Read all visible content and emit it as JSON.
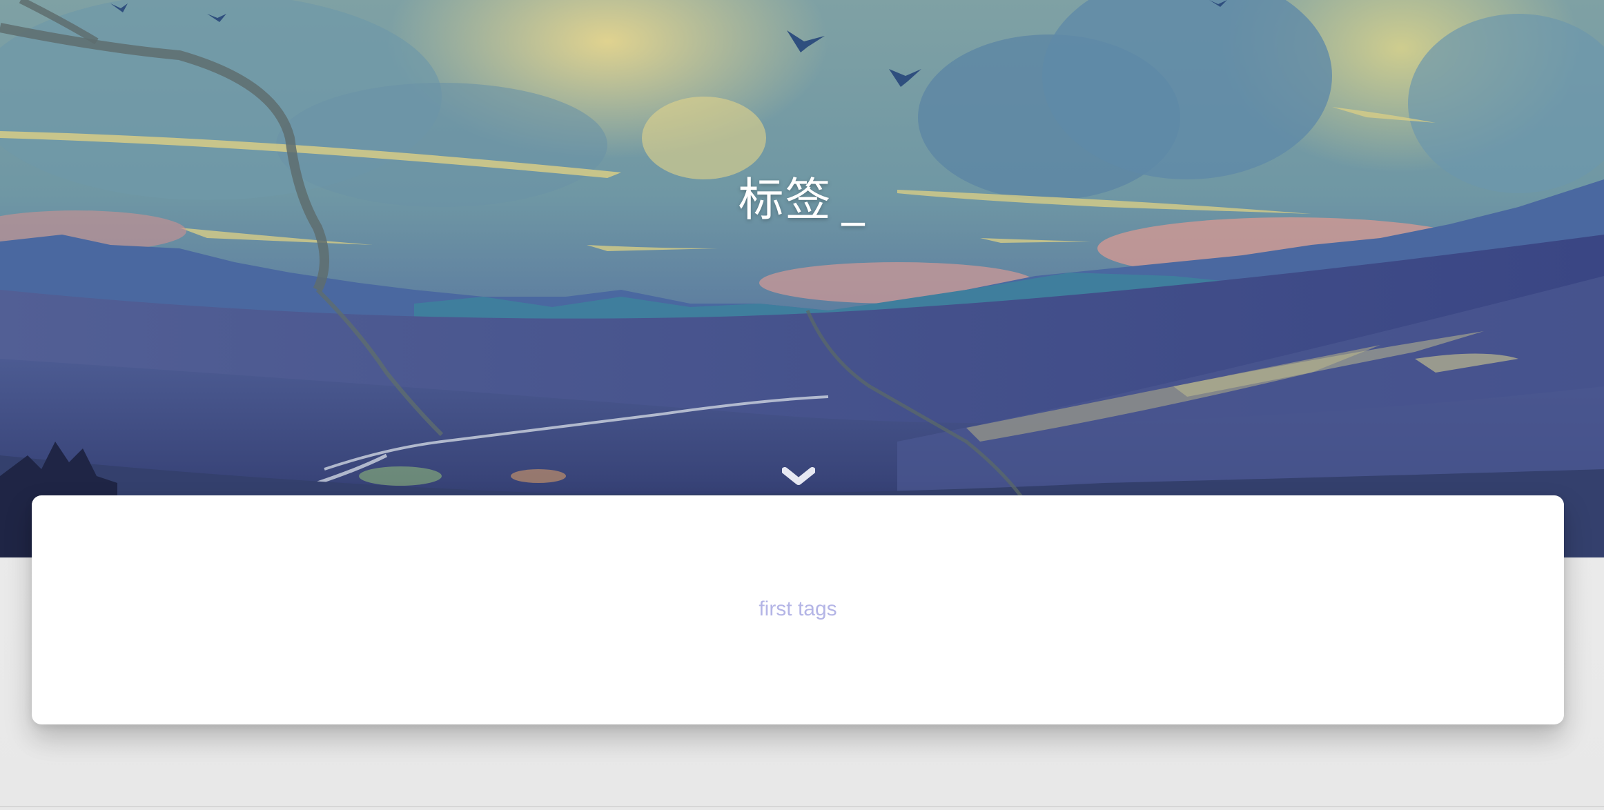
{
  "hero": {
    "title": "标签",
    "cursor": "_",
    "scroll_icon": "chevron-down-icon"
  },
  "tags": {
    "items": [
      {
        "label": "first tags"
      }
    ]
  },
  "colors": {
    "tag_text": "#b4b5e6",
    "page_background": "#ececec",
    "card_background": "#ffffff"
  }
}
